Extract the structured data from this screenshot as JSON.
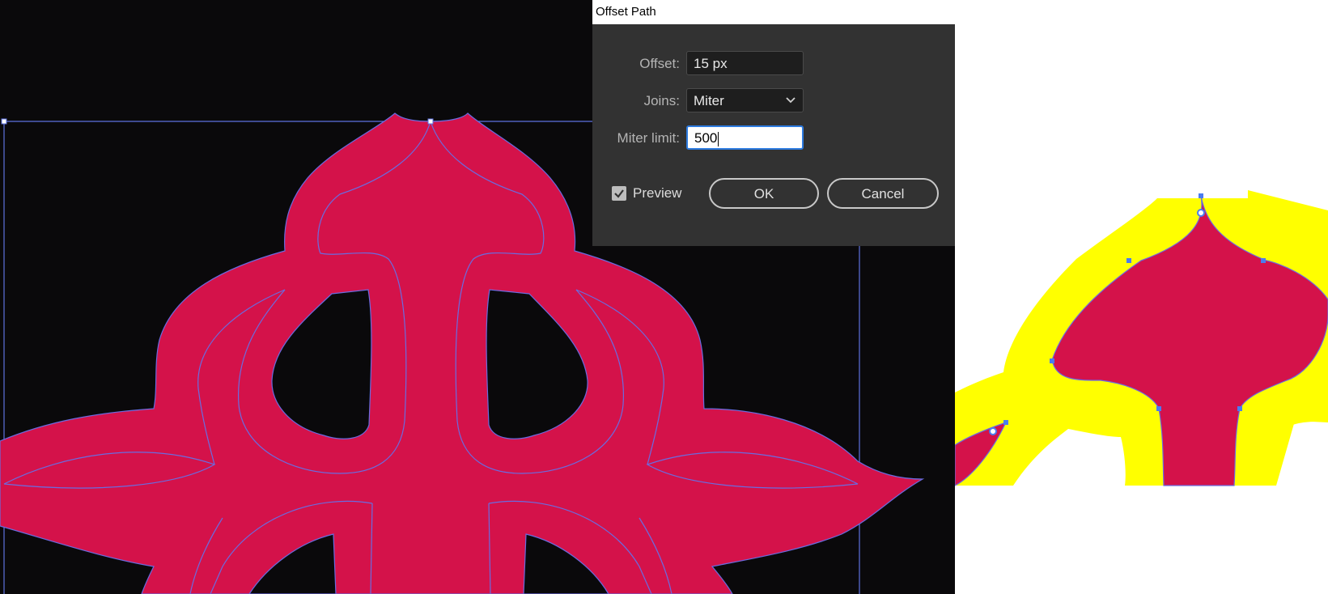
{
  "dialog": {
    "title": "Offset Path",
    "offset_label": "Offset:",
    "offset_value": "15 px",
    "joins_label": "Joins:",
    "joins_value": "Miter",
    "miter_label": "Miter limit:",
    "miter_value": "500",
    "preview_label": "Preview",
    "preview_checked": true,
    "ok_label": "OK",
    "cancel_label": "Cancel"
  },
  "colors": {
    "artwork_fill": "#d4124a",
    "outline": "#6a6ce0",
    "offset_fill": "#ffff00",
    "canvas_dark": "#0a090b",
    "selection": "#4a7cf0"
  },
  "icons": {
    "dropdown": "chevron-down-icon",
    "preview_check": "check-icon"
  }
}
